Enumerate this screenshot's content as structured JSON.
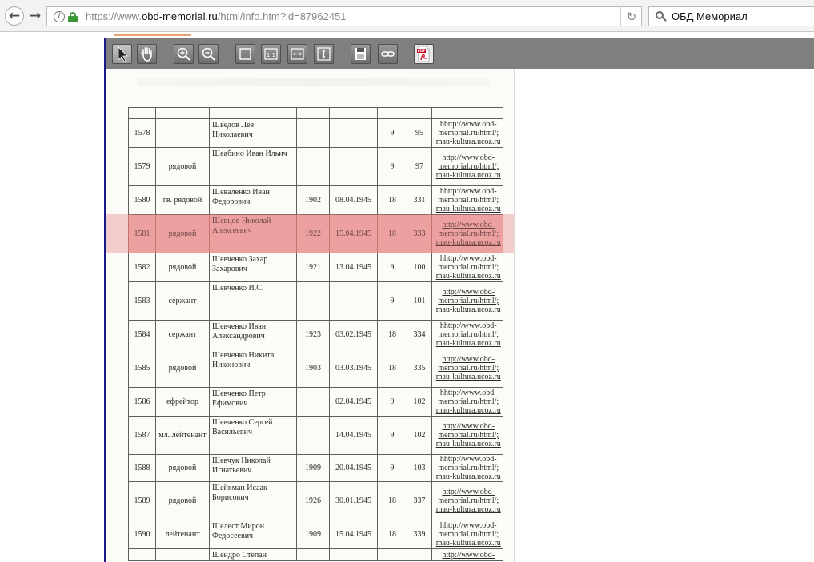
{
  "browser": {
    "url_prefix": "https://www.",
    "url_host": "obd-memorial.ru",
    "url_path": "/html/info.htm?id=87962451",
    "search_text": "ОБД Мемориал",
    "icons": [
      "back-arrow-icon",
      "forward-arrow-icon",
      "info-icon",
      "lock-icon",
      "reload-icon",
      "search-icon"
    ]
  },
  "viewer": {
    "toolbar_icons": [
      "select-pointer-icon",
      "pan-hand-icon",
      "zoom-in-icon",
      "zoom-out-icon",
      "fit-page-icon",
      "actual-size-icon",
      "fit-width-icon",
      "fit-height-icon",
      "save-disk-icon",
      "link-icon",
      "pdf-icon"
    ],
    "zoom_actual_label": "1:1",
    "pdf_label": "PDF"
  },
  "table": {
    "rows": [
      {
        "num": "1578",
        "rank": "",
        "name": "Шведов Лев Николаевич",
        "year": "",
        "date": "",
        "v1": "9",
        "v2": "95",
        "link": [
          "hhttp://www.obd-",
          "memorial.ru/html/;",
          "mau-kultura.ucoz.ru"
        ]
      },
      {
        "num": "1579",
        "rank": "рядовой",
        "name": "Шеабино Иван Ильич",
        "year": "",
        "date": "",
        "v1": "9",
        "v2": "97",
        "link": [
          "http://www.obd-",
          "memorial.ru/html/;",
          "mau-kultura.ucoz.ru"
        ]
      },
      {
        "num": "1580",
        "rank": "гв. рядовой",
        "name": "Шеваленко Иван Федорович",
        "year": "1902",
        "date": "08.04.1945",
        "v1": "18",
        "v2": "331",
        "link": [
          "hhttp://www.obd-",
          "memorial.ru/html/;",
          "mau-kultura.ucoz.ru"
        ]
      },
      {
        "num": "1581",
        "rank": "рядовой",
        "name": "Шевцов Николай Алексеевич",
        "year": "1922",
        "date": "15.04.1945",
        "v1": "18",
        "v2": "333",
        "link": [
          "http://www.obd-",
          "memorial.ru/html/;",
          "mau-kultura.ucoz.ru"
        ]
      },
      {
        "num": "1582",
        "rank": "рядовой",
        "name": "Шевченко Захар Захарович",
        "year": "1921",
        "date": "13.04.1945",
        "v1": "9",
        "v2": "100",
        "link": [
          "hhttp://www.obd-",
          "memorial.ru/html/;",
          "mau-kultura.ucoz.ru"
        ]
      },
      {
        "num": "1583",
        "rank": "сержант",
        "name": "Шевченко И.С.",
        "year": "",
        "date": "",
        "v1": "9",
        "v2": "101",
        "link": [
          "http://www.obd-",
          "memorial.ru/html/;",
          "mau-kultura.ucoz.ru"
        ]
      },
      {
        "num": "1584",
        "rank": "сержант",
        "name": "Шевченко Иван Александрович",
        "year": "1923",
        "date": "03.02.1945",
        "v1": "18",
        "v2": "334",
        "link": [
          "hhttp://www.obd-",
          "memorial.ru/html/;",
          "mau-kultura.ucoz.ru"
        ]
      },
      {
        "num": "1585",
        "rank": "рядовой",
        "name": "Шевченко Никита Никонович",
        "year": "1903",
        "date": "03.03.1945",
        "v1": "18",
        "v2": "335",
        "link": [
          "http://www.obd-",
          "memorial.ru/html/;",
          "mau-kultura.ucoz.ru"
        ]
      },
      {
        "num": "1586",
        "rank": "ефрейтор",
        "name": "Шевченко Петр Ефимович",
        "year": "",
        "date": "02.04.1945",
        "v1": "9",
        "v2": "102",
        "link": [
          "hhttp://www.obd-",
          "memorial.ru/html/;",
          "mau-kultura.ucoz.ru"
        ]
      },
      {
        "num": "1587",
        "rank": "мл. лейтенант",
        "name": "Шевченко Сергей Васильевич",
        "year": "",
        "date": "14.04.1945",
        "v1": "9",
        "v2": "102",
        "link": [
          "http://www.obd-",
          "memorial.ru/html/;",
          "mau-kultura.ucoz.ru"
        ]
      },
      {
        "num": "1588",
        "rank": "рядовой",
        "name": "Шевчук Николай Игнатьевич",
        "year": "1909",
        "date": "20.04.1945",
        "v1": "9",
        "v2": "103",
        "link": [
          "hhttp://www.obd-",
          "memorial.ru/html/;",
          "mau-kultura.ucoz.ru"
        ]
      },
      {
        "num": "1589",
        "rank": "рядовой",
        "name": "Шейкман Исаак Борисович",
        "year": "1926",
        "date": "30.01.1945",
        "v1": "18",
        "v2": "337",
        "link": [
          "http://www.obd-",
          "memorial.ru/html/;",
          "mau-kultura.ucoz.ru"
        ]
      },
      {
        "num": "1590",
        "rank": "лейтенант",
        "name": "Шелест Мирон Федосеевич",
        "year": "1909",
        "date": "15.04.1945",
        "v1": "18",
        "v2": "339",
        "link": [
          "hhttp://www.obd-",
          "memorial.ru/html/;",
          "mau-kultura.ucoz.ru"
        ]
      },
      {
        "num": "",
        "rank": "",
        "name": "Шендро Степан",
        "year": "",
        "date": "",
        "v1": "",
        "v2": "",
        "link": [
          "http://www.obd-"
        ]
      }
    ],
    "selected_row_index": 3,
    "highlight_color": "#f0b6b6"
  }
}
